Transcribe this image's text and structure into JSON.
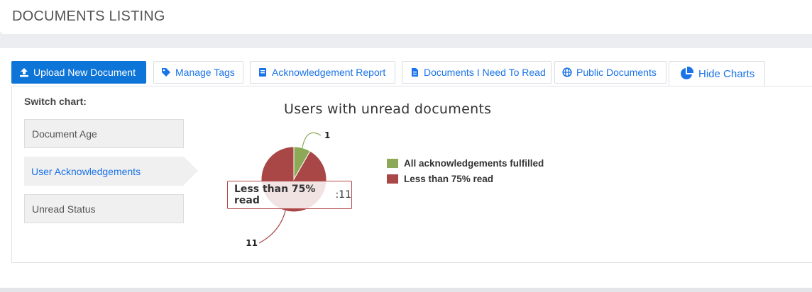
{
  "header": {
    "title": "DOCUMENTS LISTING"
  },
  "toolbar": {
    "upload_label": "Upload New Document",
    "tags_label": "Manage Tags",
    "ack_report_label": "Acknowledgement Report",
    "need_to_read_label": "Documents I Need To Read",
    "public_label": "Public Documents",
    "hide_charts_label": "Hide Charts"
  },
  "switch": {
    "label": "Switch chart:",
    "items": [
      {
        "label": "Document Age"
      },
      {
        "label": "User Acknowledgements"
      },
      {
        "label": "Unread Status"
      }
    ],
    "selected": 1
  },
  "colors": {
    "accent": "#0d74d8",
    "green": "#8ba956",
    "red": "#a94646"
  },
  "tooltip": {
    "series": "Less than 75% read",
    "sep": ": ",
    "value": "11"
  },
  "chart_data": {
    "type": "pie",
    "title": "Users with unread documents",
    "series": [
      {
        "name": "All acknowledgements fulfilled",
        "value": 1,
        "color": "#8ba956"
      },
      {
        "name": "Less than 75% read",
        "value": 11,
        "color": "#a94646"
      }
    ],
    "legend": "right"
  }
}
